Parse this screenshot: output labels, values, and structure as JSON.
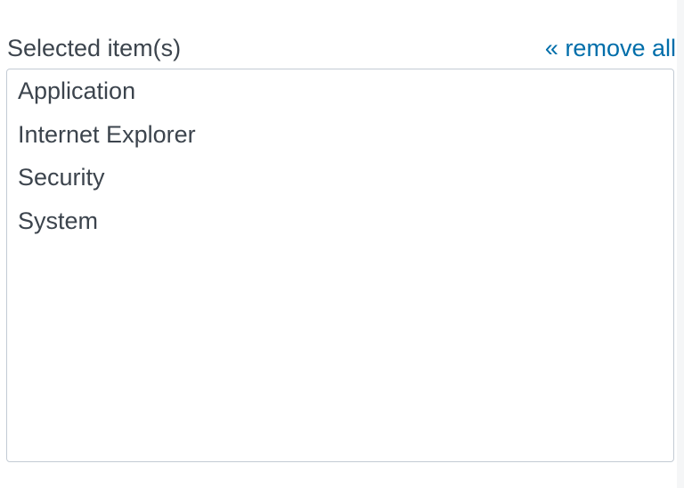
{
  "selected_panel": {
    "title": "Selected item(s)",
    "remove_all_label": "« remove all",
    "items": [
      {
        "label": "Application"
      },
      {
        "label": "Internet Explorer"
      },
      {
        "label": "Security"
      },
      {
        "label": "System"
      }
    ]
  },
  "colors": {
    "text": "#3c444d",
    "link": "#006eaa",
    "border": "#c3cbd4"
  }
}
